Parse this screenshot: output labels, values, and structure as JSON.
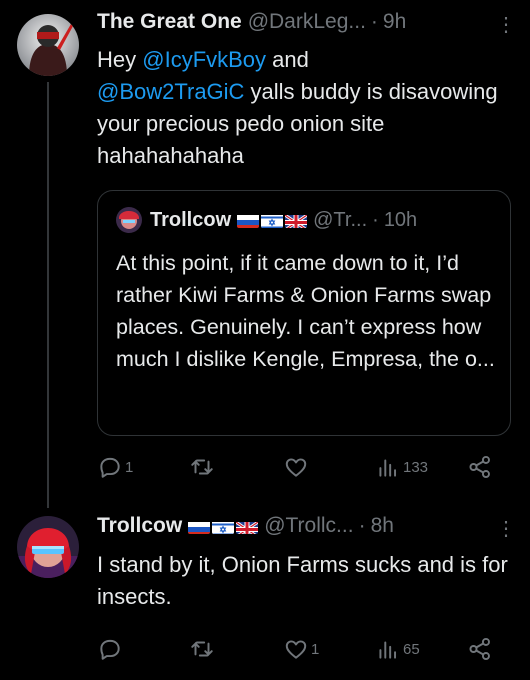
{
  "tweet1": {
    "name": "The Great One",
    "handle": "@DarkLeg...",
    "separator": "·",
    "time": "9h",
    "more": "⋮",
    "text_pre": "Hey ",
    "mention1": "@IcyFvkBoy",
    "text_mid": " and ",
    "mention2": "@Bow2TraGiC",
    "text_post": " yalls buddy is disavowing your precious pedo onion site hahahahahaha",
    "quote": {
      "name": "Trollcow",
      "handle": "@Tr...",
      "separator": "·",
      "time": "10h",
      "text": "At this point, if it came down to it, I’d rather Kiwi Farms & Onion Farms swap places. Genuinely. I can’t express how much I dislike Kengle, Empresa, the o..."
    },
    "actions": {
      "replies": "1",
      "retweets": "",
      "likes": "",
      "views": "133"
    }
  },
  "tweet2": {
    "name": "Trollcow",
    "handle": "@Trollc...",
    "separator": "·",
    "time": "8h",
    "more": "⋮",
    "text": "I stand by it, Onion Farms sucks and is for insects.",
    "actions": {
      "replies": "",
      "retweets": "",
      "likes": "1",
      "views": "65"
    }
  },
  "colors": {
    "background": "#000000",
    "text": "#e7e9ea",
    "muted": "#71767b",
    "link": "#1d9bf0",
    "border": "#2f3336"
  },
  "icons": [
    "reply-icon",
    "retweet-icon",
    "like-icon",
    "views-icon",
    "share-icon",
    "more-icon",
    "russia-flag-icon",
    "israel-flag-icon",
    "uk-flag-icon"
  ]
}
